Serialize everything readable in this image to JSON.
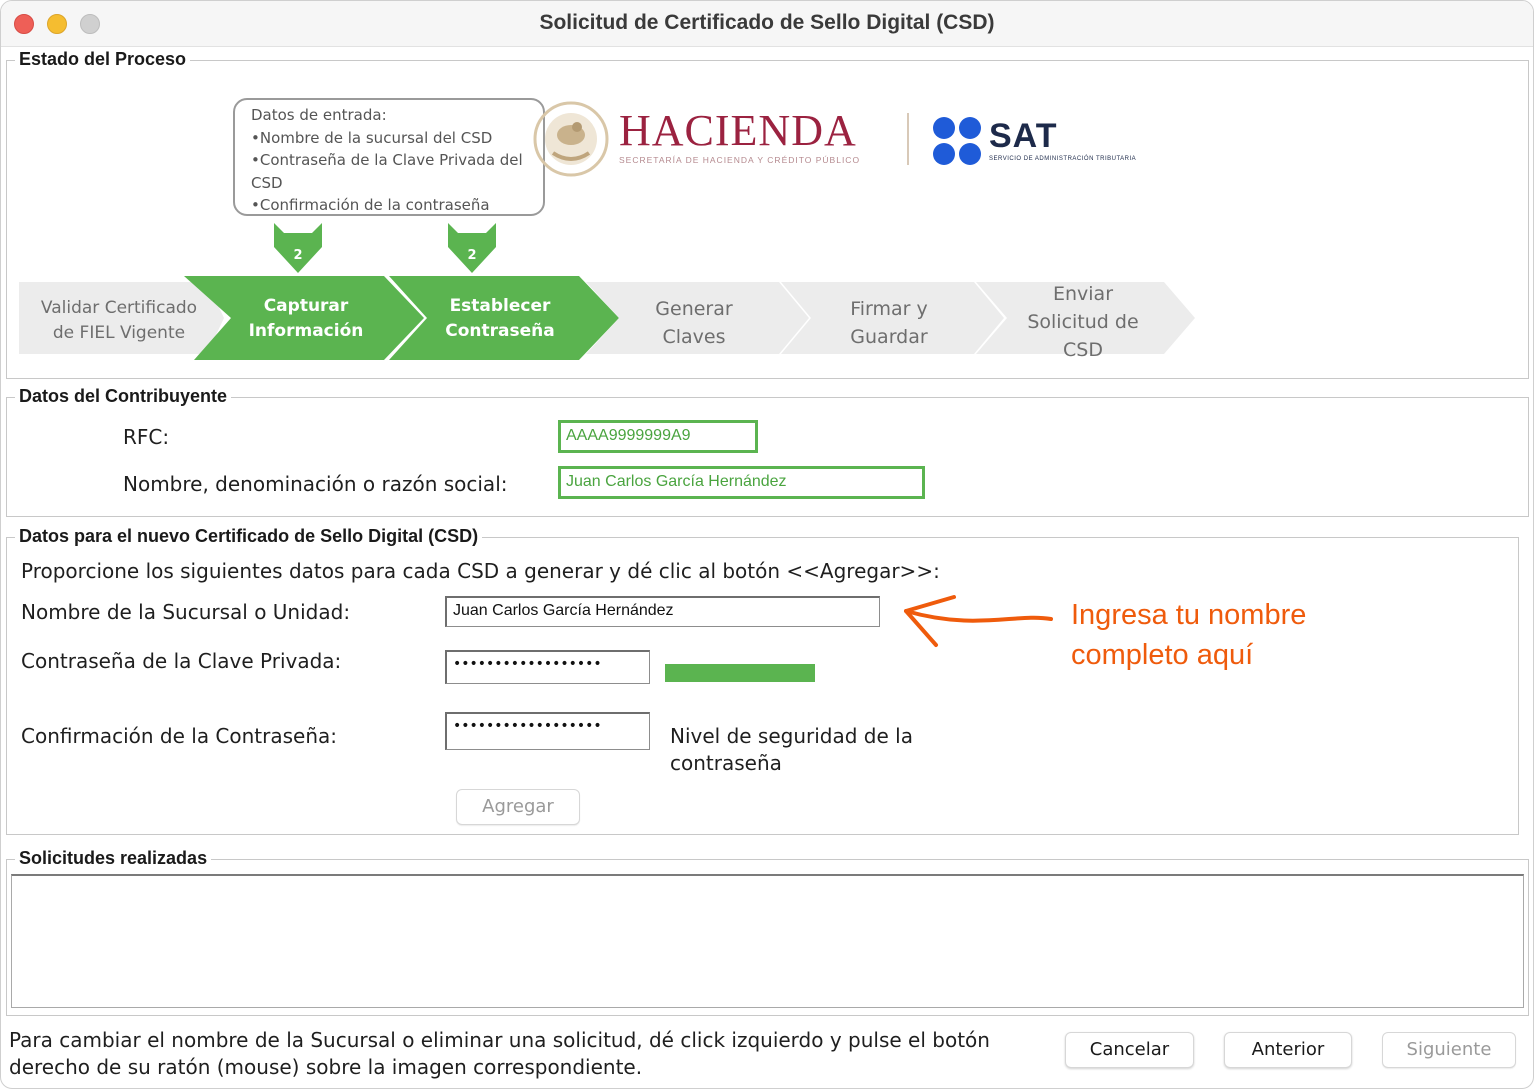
{
  "window": {
    "title": "Solicitud de Certificado de Sello Digital (CSD)"
  },
  "process": {
    "title": "Estado del Proceso",
    "callout": {
      "heading": "Datos de entrada:",
      "items": [
        "Nombre de la sucursal del CSD",
        "Contraseña de la Clave Privada del CSD",
        "Confirmación de la contraseña"
      ]
    },
    "markers": [
      "2",
      "2"
    ],
    "steps": [
      {
        "lines": [
          "Validar Certificado",
          "de FIEL Vigente"
        ],
        "state": "done"
      },
      {
        "lines": [
          "Capturar",
          "Información"
        ],
        "state": "active"
      },
      {
        "lines": [
          "Establecer",
          "Contraseña"
        ],
        "state": "active"
      },
      {
        "lines": [
          "Generar",
          "Claves"
        ],
        "state": "pending"
      },
      {
        "lines": [
          "Firmar y",
          "Guardar"
        ],
        "state": "pending"
      },
      {
        "lines": [
          "Enviar",
          "Solicitud de",
          "CSD"
        ],
        "state": "pending"
      }
    ],
    "logos": {
      "hacienda": "HACIENDA",
      "hacienda_sub": "SECRETARÍA DE HACIENDA Y CRÉDITO PÚBLICO",
      "sat": "SAT",
      "sat_sub": "SERVICIO DE ADMINISTRACIÓN TRIBUTARIA"
    }
  },
  "contribuyente": {
    "title": "Datos del Contribuyente",
    "rfc_label": "RFC:",
    "rfc_value": "AAAA9999999A9",
    "name_label": "Nombre, denominación o razón social:",
    "name_value": "Juan Carlos García Hernández"
  },
  "csd": {
    "title": "Datos para el nuevo Certificado de Sello Digital (CSD)",
    "instruction": "Proporcione los siguientes datos para cada CSD a generar y dé clic al botón <<Agregar>>:",
    "sucursal_label": "Nombre de la Sucursal o Unidad:",
    "sucursal_value": "Juan Carlos García Hernández",
    "password_label": "Contraseña de la Clave Privada:",
    "password_mask": "••••••••••••••••••",
    "confirm_label": "Confirmación de la Contraseña:",
    "confirm_mask": "••••••••••••••••••",
    "strength_line1": "Nivel de seguridad de la",
    "strength_line2": "contraseña",
    "strength_level": 1.0,
    "strength_color": "#5bb450",
    "add_button": "Agregar"
  },
  "annotation": {
    "line1": "Ingresa tu nombre",
    "line2": "completo aquí",
    "color": "#ef5b0c"
  },
  "solicitudes": {
    "title": "Solicitudes realizadas"
  },
  "footer": {
    "line1": "Para cambiar el nombre de la Sucursal o eliminar una solicitud, dé click izquierdo y pulse el botón",
    "line2": "derecho de su ratón (mouse) sobre la imagen correspondiente.",
    "cancel": "Cancelar",
    "previous": "Anterior",
    "next": "Siguiente"
  }
}
